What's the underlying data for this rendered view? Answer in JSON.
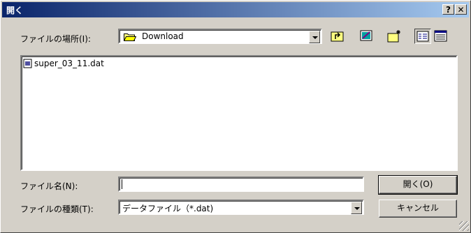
{
  "window": {
    "title": "開く",
    "help_glyph": "?",
    "close_glyph": "✕"
  },
  "location": {
    "label": "ファイルの場所(I):",
    "value": "Download"
  },
  "toolbar": {
    "icons": [
      "up-folder-icon",
      "desktop-icon",
      "new-folder-icon",
      "list-view-icon",
      "details-view-icon"
    ]
  },
  "files": [
    {
      "name": "super_03_11.dat"
    }
  ],
  "filename": {
    "label": "ファイル名(N):",
    "value": ""
  },
  "filetype": {
    "label": "ファイルの種類(T):",
    "value": "データファイル（*.dat)"
  },
  "buttons": {
    "open": "開く(O)",
    "cancel": "キャンセル"
  }
}
